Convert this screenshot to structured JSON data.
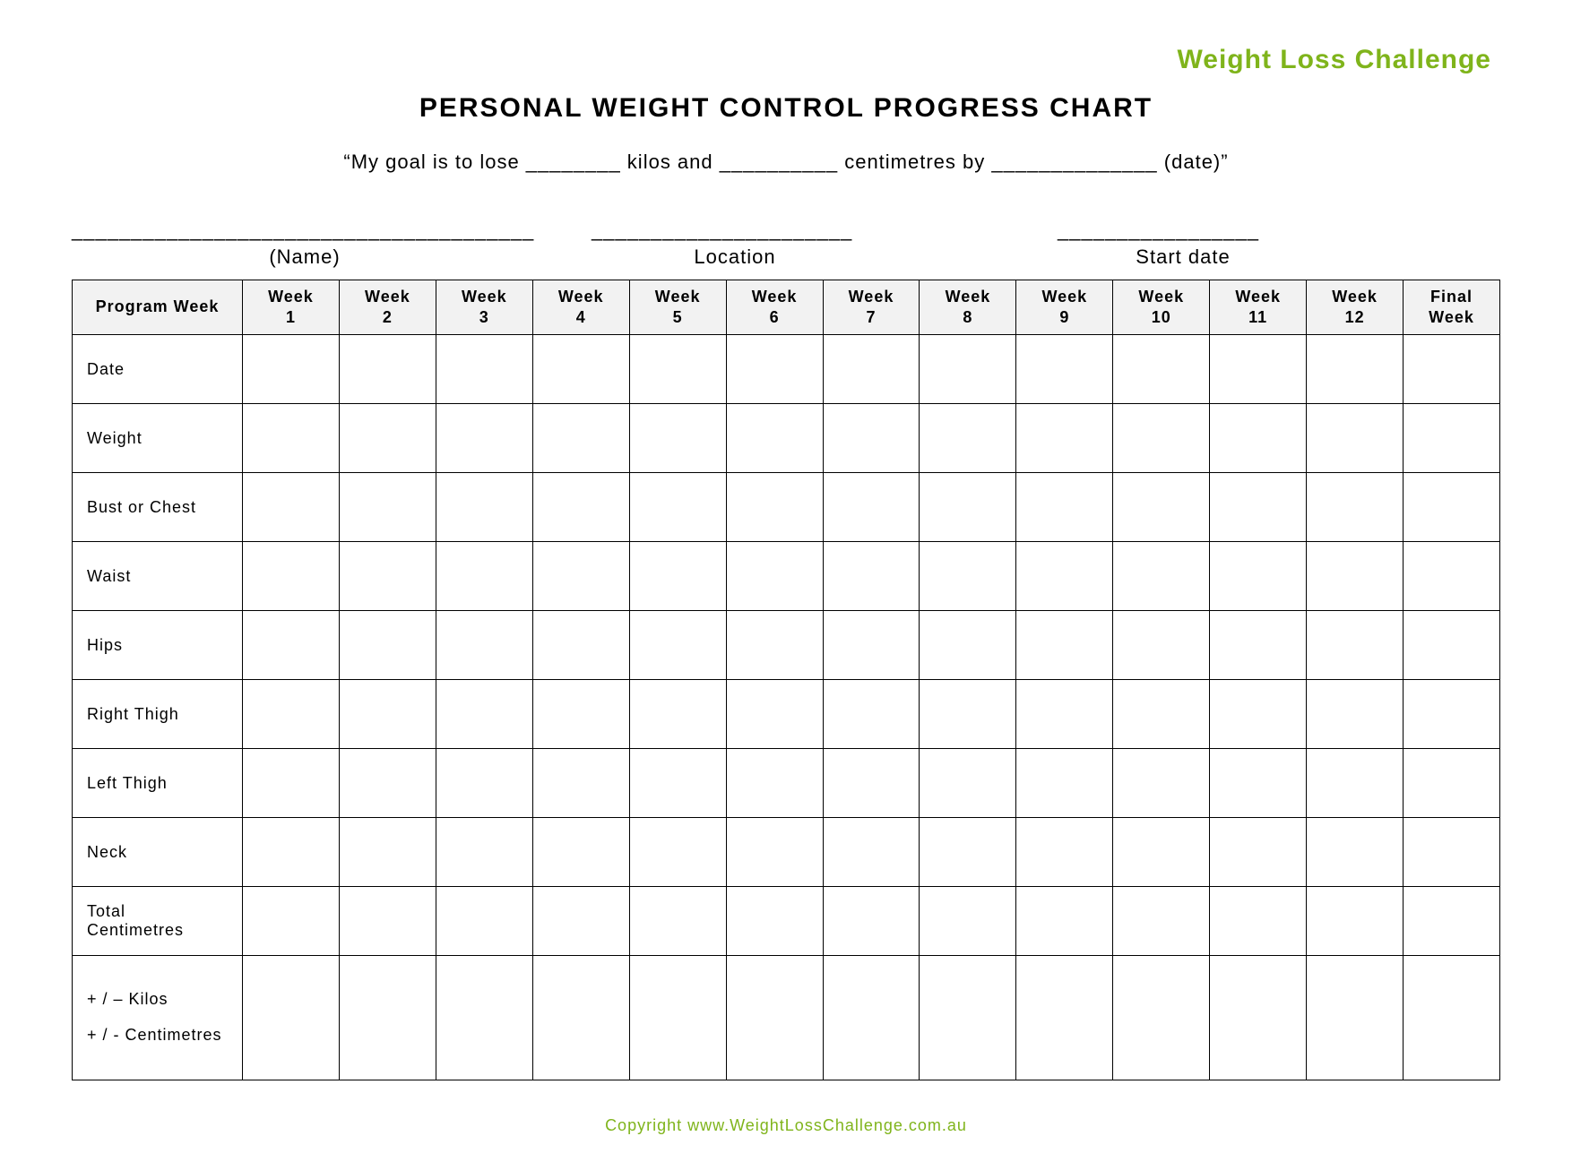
{
  "brand": "Weight Loss Challenge",
  "title": "PERSONAL WEIGHT CONTROL PROGRESS CHART",
  "goal_line": "“My goal is to lose ________ kilos and __________ centimetres by ______________ (date)”",
  "blanks": {
    "name_line": "_______________________________________",
    "location_line": "______________________",
    "startdate_line": "_________________"
  },
  "field_labels": {
    "name": "(Name)",
    "location": "Location",
    "start_date": "Start date"
  },
  "columns": [
    "Program Week",
    "Week 1",
    "Week 2",
    "Week 3",
    "Week 4",
    "Week 5",
    "Week 6",
    "Week 7",
    "Week 8",
    "Week 9",
    "Week 10",
    "Week 11",
    "Week 12",
    "Final Week"
  ],
  "rows": [
    "Date",
    "Weight",
    "Bust or Chest",
    "Waist",
    "Hips",
    "Right Thigh",
    "Left Thigh",
    "Neck",
    "Total Centimetres"
  ],
  "last_row": "+ / – Kilos\n+ / - Centimetres",
  "copyright": "Copyright www.WeightLossChallenge.com.au"
}
